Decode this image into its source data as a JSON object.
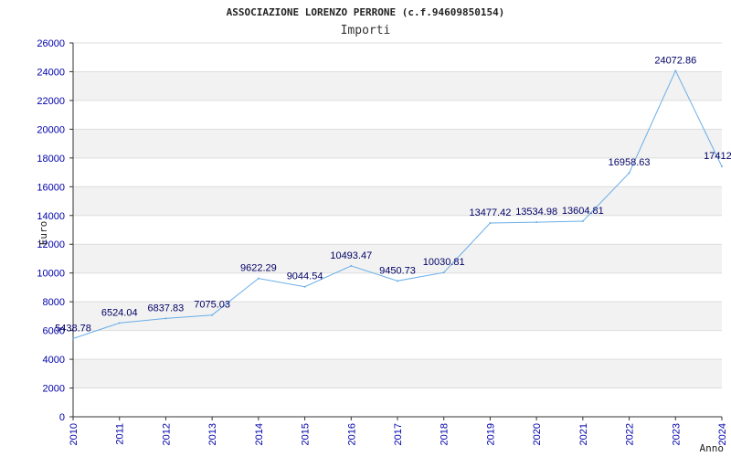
{
  "chart_data": {
    "type": "line",
    "title": "ASSOCIAZIONE LORENZO PERRONE (c.f.94609850154)",
    "subtitle": "Importi",
    "xlabel": "Anno",
    "ylabel": "Euro",
    "x": [
      "2010",
      "2011",
      "2012",
      "2013",
      "2014",
      "2015",
      "2016",
      "2017",
      "2018",
      "2019",
      "2020",
      "2021",
      "2022",
      "2023",
      "2024"
    ],
    "values": [
      5438.78,
      6524.04,
      6837.83,
      7075.03,
      9622.29,
      9044.54,
      10493.47,
      9450.73,
      10030.81,
      13477.42,
      13534.98,
      13604.81,
      16958.63,
      24072.86,
      17412.0
    ],
    "data_labels": [
      "5438.78",
      "6524.04",
      "6837.83",
      "7075.03",
      "9622.29",
      "9044.54",
      "10493.47",
      "9450.73",
      "10030.81",
      "13477.42",
      "13534.98",
      "13604.81",
      "16958.63",
      "24072.86",
      "17412.0"
    ],
    "ylim": [
      0,
      26000
    ],
    "yticks": [
      0,
      2000,
      4000,
      6000,
      8000,
      10000,
      12000,
      14000,
      16000,
      18000,
      20000,
      22000,
      24000,
      26000
    ],
    "grid": true,
    "colors": {
      "line": "#6aaee8",
      "band": "#f2f2f2",
      "grid": "#dddddd",
      "axis": "#333333",
      "tick_text": "#0000aa",
      "label_text": "#000066"
    }
  }
}
